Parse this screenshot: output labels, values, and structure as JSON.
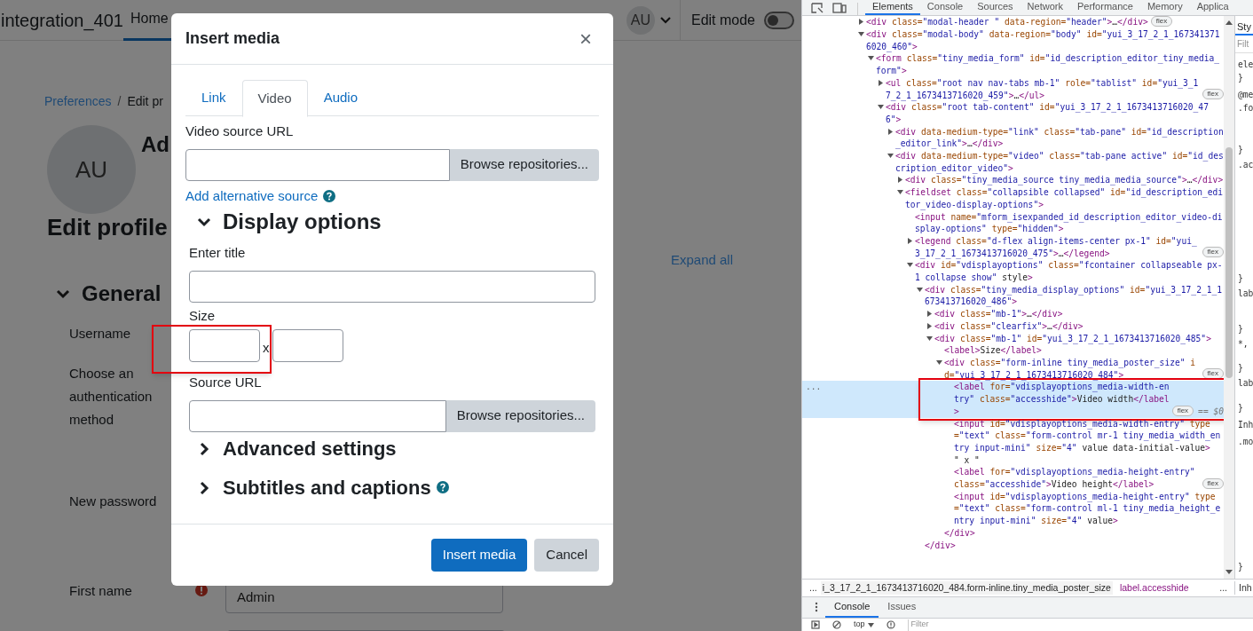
{
  "site_header": {
    "site_name": "integration_401",
    "nav": [
      {
        "label": "Home",
        "selected": true
      }
    ],
    "avatar": "AU",
    "edit_mode": {
      "label": "Edit mode",
      "on": false
    }
  },
  "page": {
    "breadcrumb": [
      "Preferences",
      "/",
      "Edit pr"
    ],
    "avatar": "AU",
    "user_name": "Ad",
    "heading": "Edit profile",
    "expand_all": "Expand all",
    "section": {
      "title": "General",
      "expanded": true
    },
    "fields": [
      {
        "label": "Username",
        "required": false
      },
      {
        "label": "Choose an authentication method",
        "required": false
      },
      {
        "label": "New password",
        "required": false
      },
      {
        "label": "First name",
        "required": true,
        "value": "Admin"
      }
    ]
  },
  "modal": {
    "title": "Insert media",
    "close": "×",
    "tabs": [
      {
        "label": "Link",
        "selected": false
      },
      {
        "label": "Video",
        "selected": true
      },
      {
        "label": "Audio",
        "selected": false
      }
    ],
    "source_label": "Video source URL",
    "source_browse": "Browse repositories...",
    "add_alternative": "Add alternative source",
    "display_options": {
      "title": "Display options",
      "expanded": true
    },
    "enter_title": "Enter title",
    "size_label": "Size",
    "size_separator": "x",
    "poster_label": "Source URL",
    "poster_browse": "Browse repositories...",
    "sections": [
      {
        "title": "Advanced settings",
        "expanded": false,
        "help": false
      },
      {
        "title": "Subtitles and captions",
        "expanded": false,
        "help": true
      }
    ],
    "buttons": [
      {
        "label": "Insert media",
        "kind": "primary"
      },
      {
        "label": "Cancel",
        "kind": "secondary"
      }
    ]
  },
  "devtools": {
    "tabs": [
      {
        "label": "Elements",
        "selected": true
      },
      {
        "label": "Console",
        "selected": false
      },
      {
        "label": "Sources",
        "selected": false
      },
      {
        "label": "Network",
        "selected": false
      },
      {
        "label": "Performance",
        "selected": false
      },
      {
        "label": "Memory",
        "selected": false
      },
      {
        "label": "Applica",
        "selected": false
      }
    ],
    "tree": [
      {
        "text": "<div class=\"modal-header \" data-region=\"header\">…</div>",
        "expanded": false,
        "badge": "flex"
      },
      {
        "text": "<div class=\"modal-body\" data-region=\"body\" id=\"yui_3_17_2_1_1673413716020_460\">",
        "expanded": true,
        "children": [
          {
            "text": "<form class=\"tiny_media_form\" id=\"id_description_editor_tiny_media_form\">",
            "expanded": true,
            "children": [
              {
                "text": "<ul class=\"root nav nav-tabs mb-1\" role=\"tablist\" id=\"yui_3_17_2_1_1673413716020_459\">…</ul>",
                "expanded": false,
                "badge": "flex"
              },
              {
                "text": "<div class=\"root tab-content\" id=\"yui_3_17_2_1_1673413716020_476\">",
                "expanded": true,
                "children": [
                  {
                    "text": "<div data-medium-type=\"link\" class=\"tab-pane\" id=\"id_description_editor_link\">…</div>",
                    "expanded": false
                  },
                  {
                    "text": "<div data-medium-type=\"video\" class=\"tab-pane active\" id=\"id_description_editor_video\">",
                    "expanded": true,
                    "children": [
                      {
                        "text": "<div class=\"tiny_media_source tiny_media_media_source\">…</div>",
                        "expanded": false
                      },
                      {
                        "text": "<fieldset class=\"collapsible collapsed\" id=\"id_description_editor_video-display-options\">",
                        "expanded": true,
                        "children": [
                          {
                            "text": "<input name=\"mform_isexpanded_id_description_editor_video-display-options\" type=\"hidden\">"
                          },
                          {
                            "text": "<legend class=\"d-flex align-items-center px-1\" id=\"yui_3_17_2_1_1673413716020_475\">…</legend>",
                            "expanded": false,
                            "badge": "flex"
                          },
                          {
                            "text": "<div id=\"vdisplayoptions\" class=\"fcontainer collapseable px-1 collapse show\" style>",
                            "expanded": true,
                            "children": [
                              {
                                "text": "<div class=\"tiny_media_display_options\" id=\"yui_3_17_2_1_1673413716020_486\">",
                                "expanded": true,
                                "closing": "</div>",
                                "children": [
                                  {
                                    "text": "<div class=\"mb-1\">…</div>",
                                    "expanded": false
                                  },
                                  {
                                    "text": "<div class=\"clearfix\">…</div>",
                                    "expanded": false
                                  },
                                  {
                                    "text": "<div class=\"mb-1\" id=\"yui_3_17_2_1_1673413716020_485\">",
                                    "expanded": true,
                                    "children": [
                                      {
                                        "text": "<label>Size</label>"
                                      },
                                      {
                                        "text": "<div class=\"form-inline tiny_media_poster_size\" id=\"yui_3_17_2_1_1673413716020_484\">",
                                        "expanded": true,
                                        "badge": "flex",
                                        "closing": "</div>",
                                        "children": [
                                          {
                                            "text": "<label for=\"vdisplayoptions_media-width-entry\" class=\"accesshide\">Video width</label>",
                                            "badge": "flex",
                                            "selected": true,
                                            "gutter": "...",
                                            "console_ref": "== $0"
                                          },
                                          {
                                            "text": "<input id=\"vdisplayoptions_media-width-entry\" type=\"text\" class=\"form-control mr-1 tiny_media_width_entry input-mini\" size=\"4\" value data-initial-value>"
                                          },
                                          {
                                            "text": "\" x \""
                                          },
                                          {
                                            "text": "<label for=\"vdisplayoptions_media-height-entry\" class=\"accesshide\">Video height</label>",
                                            "badge": "flex"
                                          },
                                          {
                                            "text": "<input id=\"vdisplayoptions_media-height-entry\" type=\"text\" class=\"form-control ml-1 tiny_media_height_entry input-mini\" size=\"4\" value>"
                                          }
                                        ]
                                      }
                                    ]
                                  }
                                ]
                              }
                            ]
                          }
                        ]
                      }
                    ]
                  }
                ]
              }
            ]
          }
        ]
      }
    ],
    "styles_pane": {
      "tab": "Sty",
      "filter_placeholder": "Filt",
      "lines": [
        "ele",
        "}",
        "@me",
        ".fo",
        "}",
        ".ac",
        "}",
        "lab",
        "}",
        "*,",
        "}",
        "lab",
        "}",
        "Inh",
        ".mo",
        "}"
      ]
    },
    "breadcrumb": [
      "...",
      "i_3_17_2_1_1673413716020_484.form-inline.tiny_media_poster_size",
      "label.accesshide",
      "...",
      "Inh"
    ],
    "drawer_tabs": [
      {
        "label": "Console",
        "selected": true
      },
      {
        "label": "Issues",
        "selected": false
      }
    ],
    "context": "top",
    "filter_placeholder": "Filter"
  }
}
